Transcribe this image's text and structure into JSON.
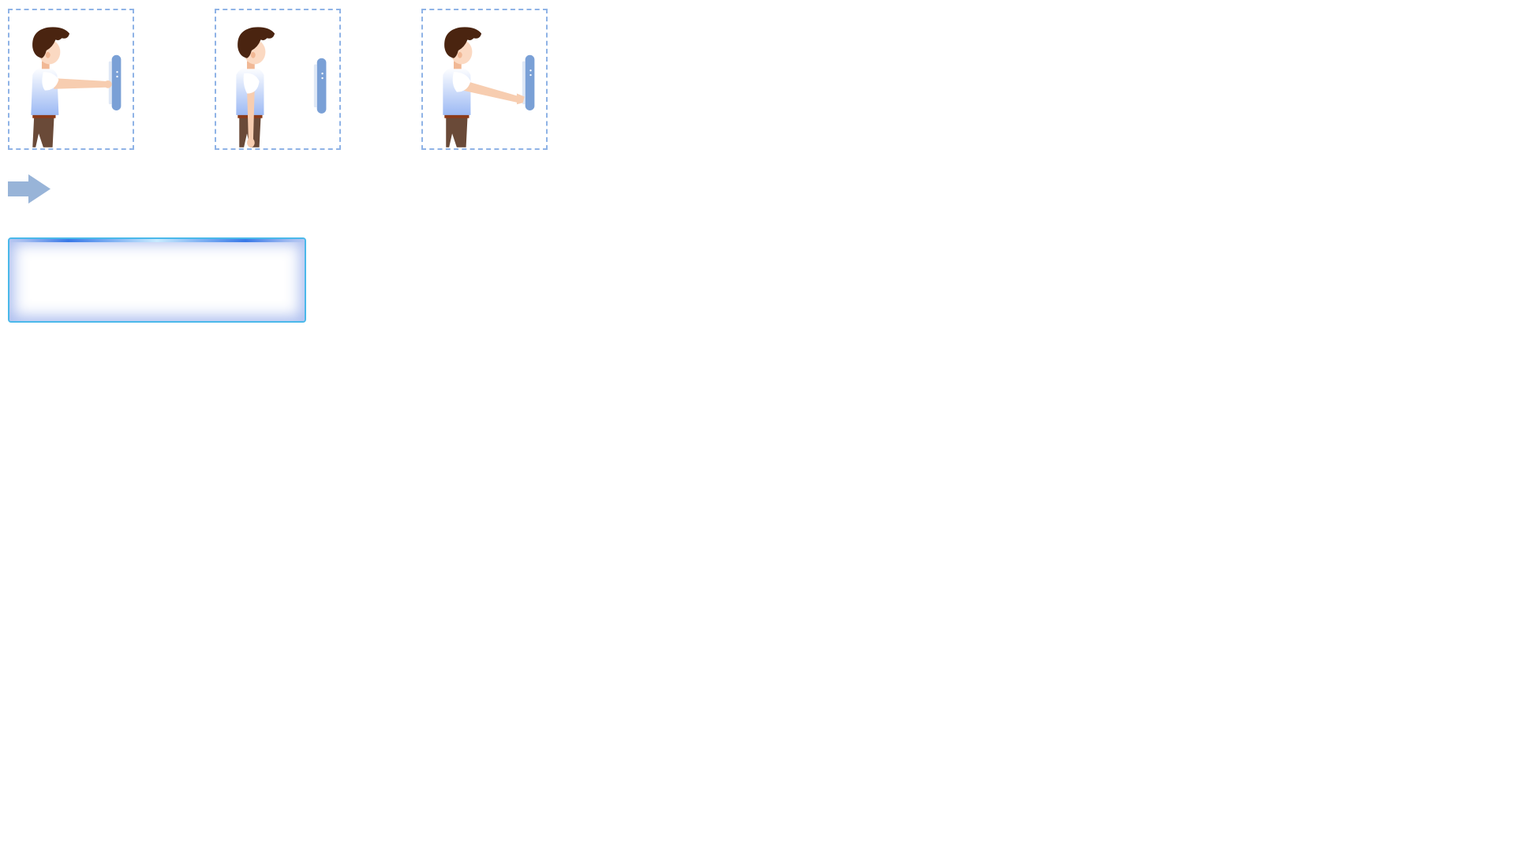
{
  "poses": [
    {
      "name": "arm-extended-pressing",
      "arm": "forward"
    },
    {
      "name": "arms-down-standing",
      "arm": "down"
    },
    {
      "name": "arm-angled-pressing",
      "arm": "angled"
    }
  ],
  "next_button": {
    "icon": "arrow-right-icon"
  },
  "message_box": {
    "text": ""
  },
  "colors": {
    "frame_border": "#8fb3e6",
    "arrow": "#98b4d8",
    "message_border": "#4ab8ea",
    "hair": "#4a2410",
    "skin": "#f7cdb0",
    "shirt_top": "#ffffff",
    "shirt_bottom": "#9cb9f4",
    "pants": "#6a4a38",
    "wall_bar": "#7aa0d6"
  }
}
